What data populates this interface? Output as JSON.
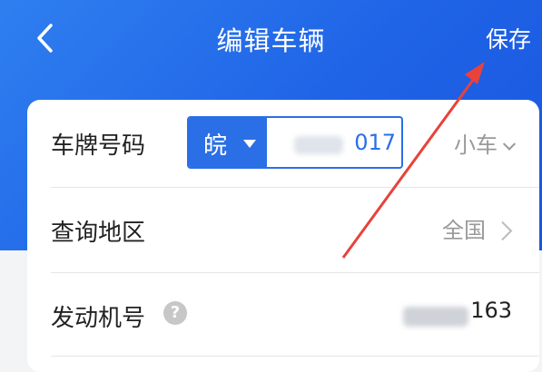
{
  "header": {
    "title": "编辑车辆",
    "save_label": "保存",
    "back_icon": "chevron-left-icon",
    "background_color": "#1f63e6"
  },
  "form": {
    "plate": {
      "label": "车牌号码",
      "province": "皖",
      "number_value": "017",
      "vehicle_type": "小车",
      "accent_color": "#2a6fe6"
    },
    "region": {
      "label": "查询地区",
      "value": "全国"
    },
    "engine": {
      "label": "发动机号",
      "help_icon": "question-icon",
      "help_glyph": "?",
      "value": "163"
    }
  },
  "annotation": {
    "type": "red-arrow",
    "color": "#e8423a",
    "points_to": "save-button"
  }
}
